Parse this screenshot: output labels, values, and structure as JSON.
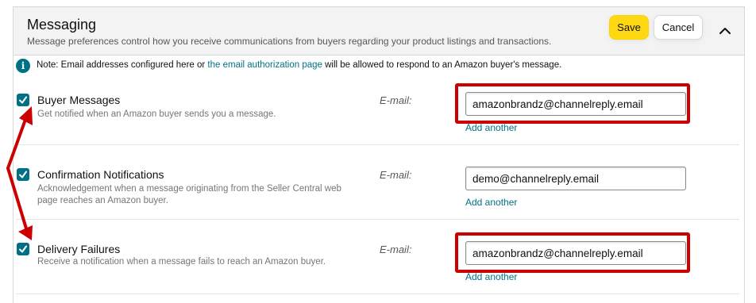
{
  "panel": {
    "title": "Messaging",
    "description": "Message preferences control how you receive communications from buyers regarding your product listings and transactions.",
    "save_label": "Save",
    "cancel_label": "Cancel"
  },
  "note": {
    "prefix": "Note: Email addresses configured here or ",
    "link": "the email authorization page",
    "suffix": " will be allowed to respond to an Amazon buyer's message."
  },
  "email_label": "E-mail:",
  "add_another_label": "Add another",
  "rows": [
    {
      "title": "Buyer Messages",
      "description": "Get notified when an Amazon buyer sends you a message.",
      "email": "amazonbrandz@channelreply.email",
      "checked": true,
      "highlighted": true
    },
    {
      "title": "Confirmation Notifications",
      "description": "Acknowledgement when a message originating from the Seller Central web page reaches an Amazon buyer.",
      "email": "demo@channelreply.email",
      "checked": true,
      "highlighted": false
    },
    {
      "title": "Delivery Failures",
      "description": "Receive a notification when a message fails to reach an Amazon buyer.",
      "email": "amazonbrandz@channelreply.email",
      "checked": true,
      "highlighted": true
    }
  ],
  "colors": {
    "accent": "#007185",
    "save_button": "#ffd814",
    "annotation": "#cc0000"
  },
  "icons": {
    "info": "info-icon",
    "check": "checkmark-icon",
    "collapse": "chevron-up-icon"
  }
}
